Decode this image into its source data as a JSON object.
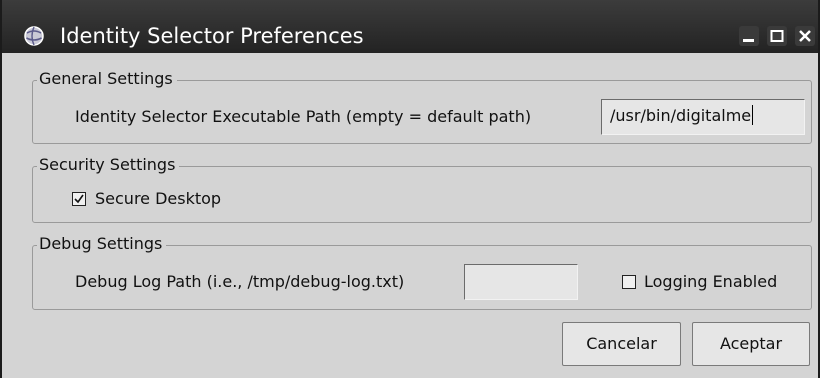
{
  "window": {
    "title": "Identity Selector Preferences",
    "icon": "app-globe-icon"
  },
  "general": {
    "legend": "General Settings",
    "exe_label": "Identity Selector Executable Path (empty = default path)",
    "exe_value": "/usr/bin/digitalme"
  },
  "security": {
    "legend": "Security Settings",
    "secure_desktop_label": "Secure Desktop",
    "secure_desktop_checked": true
  },
  "debug": {
    "legend": "Debug Settings",
    "log_path_label": "Debug Log Path (i.e., /tmp/debug-log.txt)",
    "log_path_value": "",
    "logging_label": "Logging Enabled",
    "logging_checked": false
  },
  "buttons": {
    "cancel": "Cancelar",
    "accept": "Aceptar"
  }
}
